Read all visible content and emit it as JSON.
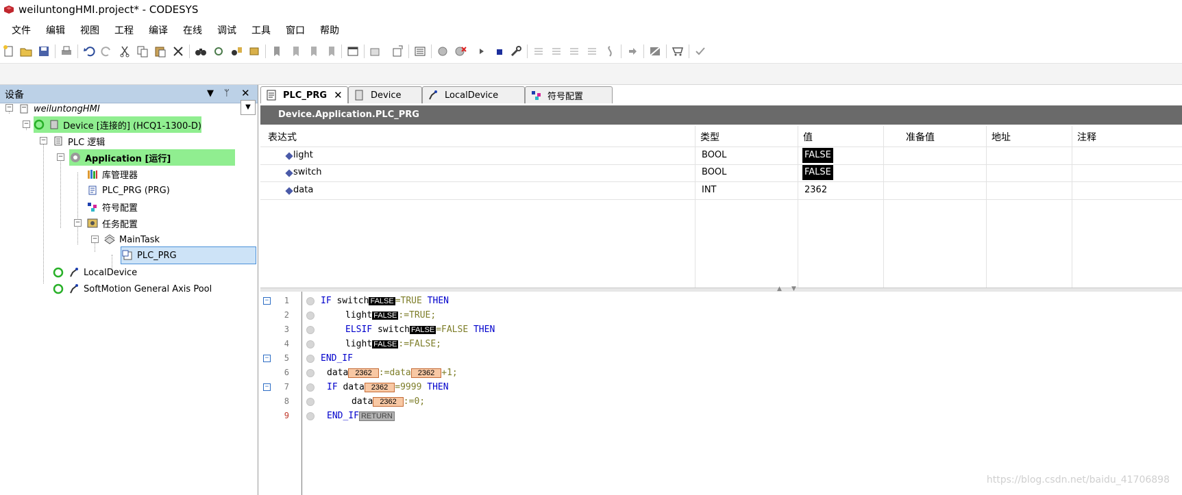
{
  "window": {
    "title": "weiluntongHMI.project* - CODESYS"
  },
  "menu": [
    "文件",
    "编辑",
    "视图",
    "工程",
    "编译",
    "在线",
    "调试",
    "工具",
    "窗口",
    "帮助"
  ],
  "device_panel": {
    "title": "设备",
    "tree": {
      "root": "weiluntongHMI",
      "device": "Device [连接的] (HCQ1-1300-D)",
      "plc_logic": "PLC 逻辑",
      "application": "Application [运行]",
      "library": "库管理器",
      "plc_prg_prg": "PLC_PRG (PRG)",
      "symbol_config": "符号配置",
      "task_config": "任务配置",
      "main_task": "MainTask",
      "plc_prg": "PLC_PRG",
      "local_device": "LocalDevice",
      "softmotion": "SoftMotion General Axis Pool"
    }
  },
  "tabs": [
    {
      "label": "PLC_PRG",
      "active": true,
      "icon": "document-icon"
    },
    {
      "label": "Device",
      "active": false,
      "icon": "device-icon"
    },
    {
      "label": "LocalDevice",
      "active": false,
      "icon": "robot-arm-icon"
    },
    {
      "label": "符号配置",
      "active": false,
      "icon": "symbol-config-icon"
    }
  ],
  "watch": {
    "path": "Device.Application.PLC_PRG",
    "headers": [
      "表达式",
      "类型",
      "值",
      "准备值",
      "地址",
      "注释"
    ],
    "rows": [
      {
        "expr": "light",
        "type": "BOOL",
        "value": "FALSE"
      },
      {
        "expr": "switch",
        "type": "BOOL",
        "value": "FALSE"
      },
      {
        "expr": "data",
        "type": "INT",
        "value": "2362"
      }
    ]
  },
  "code": {
    "line_numbers": [
      "1",
      "2",
      "3",
      "4",
      "5",
      "6",
      "7",
      "8",
      "9"
    ],
    "tokens": {
      "if": "IF",
      "then": "THEN",
      "elsif": "ELSIF",
      "end_if": "END_IF",
      "switch": "switch",
      "light": "light",
      "data": "data",
      "eq_true": "=TRUE",
      "eq_false": "=FALSE",
      "assign_true": ":=TRUE;",
      "assign_false": ":=FALSE;",
      "assign_data": ":=data",
      "plus1": "+1;",
      "eq_9999": "=9999",
      "assign_0": ":=0;",
      "false_chip": "FALSE",
      "data_chip": "2362",
      "return_chip": "RETURN"
    }
  },
  "watermark": "https://blog.csdn.net/baidu_41706898"
}
